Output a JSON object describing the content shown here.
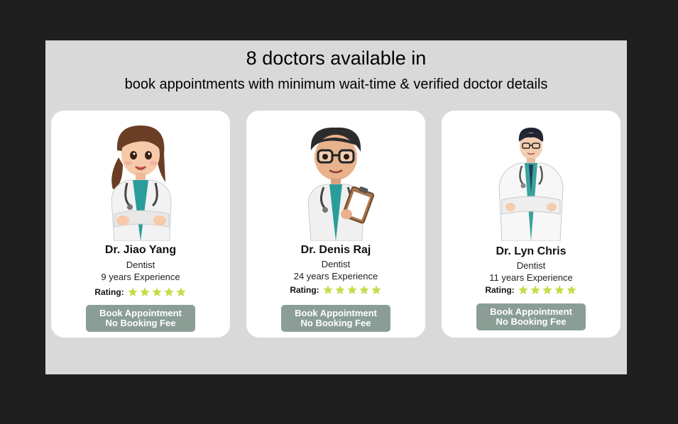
{
  "header": {
    "title": "8 doctors available in",
    "subtitle": "book appointments with minimum wait-time & verified doctor details"
  },
  "colors": {
    "background": "#1f1f1f",
    "panel": "#d9d9d9",
    "card": "#ffffff",
    "button": "#8a9e96",
    "star": "#c6dc4a"
  },
  "doctors": [
    {
      "name": "Dr. Jiao Yang",
      "specialty": "Dentist",
      "experience": "9 years Experience",
      "rating_label": "Rating:",
      "rating": 5,
      "button_line1": "Book Appointment",
      "button_line2": "No Booking Fee",
      "avatar": "female-doctor-avatar"
    },
    {
      "name": "Dr. Denis Raj",
      "specialty": "Dentist",
      "experience": "24 years Experience",
      "rating_label": "Rating:",
      "rating": 5,
      "button_line1": "Book Appointment",
      "button_line2": "No Booking Fee",
      "avatar": "male-doctor-clipboard-avatar"
    },
    {
      "name": "Dr. Lyn Chris",
      "specialty": "Dentist",
      "experience": "11 years Experience",
      "rating_label": "Rating:",
      "rating": 5,
      "button_line1": "Book Appointment",
      "button_line2": "No Booking Fee",
      "avatar": "male-doctor-avatar"
    }
  ]
}
